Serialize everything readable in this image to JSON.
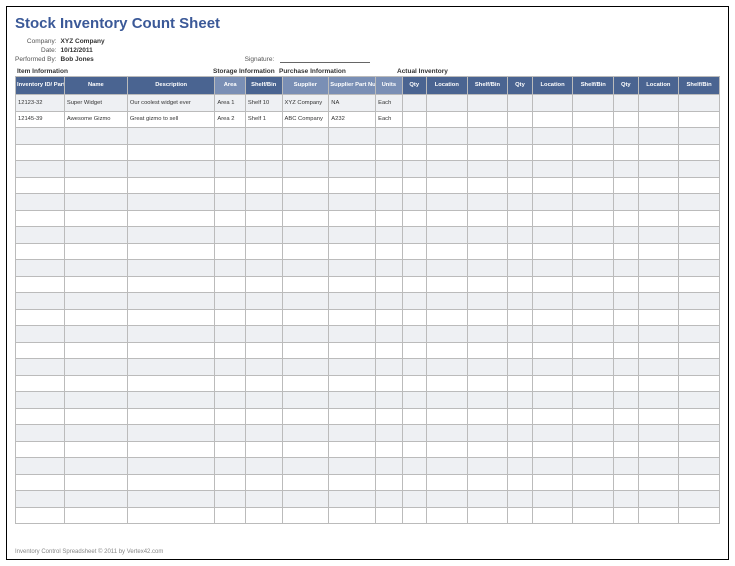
{
  "title": "Stock Inventory Count Sheet",
  "meta": {
    "company_label": "Company:",
    "company": "XYZ Company",
    "date_label": "Date:",
    "date": "10/12/2011",
    "performed_label": "Performed By:",
    "performed_by": "Bob Jones",
    "signature_label": "Signature:"
  },
  "groups": {
    "item": "Item Information",
    "storage": "Storage Information",
    "purchase": "Purchase Information",
    "actual": "Actual Inventory"
  },
  "headers": {
    "inv_id": "Inventory ID/\nPart Number",
    "name": "Name",
    "desc": "Description",
    "area": "Area",
    "shelf": "Shelf/Bin",
    "supplier": "Supplier",
    "supp_part": "Supplier Part\nNumber",
    "units": "Units",
    "qty": "Qty",
    "location": "Location",
    "shelfbin": "Shelf/Bin"
  },
  "rows": [
    {
      "id": "12123-32",
      "name": "Super Widget",
      "desc": "Our coolest widget ever",
      "area": "Area 1",
      "shelf": "Shelf 10",
      "supplier": "XYZ Company",
      "supp_part": "NA",
      "units": "Each"
    },
    {
      "id": "12145-39",
      "name": "Awesome Gizmo",
      "desc": "Great gizmo to sell",
      "area": "Area 2",
      "shelf": "Shelf 1",
      "supplier": "ABC Company",
      "supp_part": "A232",
      "units": "Each"
    }
  ],
  "empty_rows": 24,
  "footer": "Inventory Control Spreadsheet © 2011 by Vertex42.com"
}
